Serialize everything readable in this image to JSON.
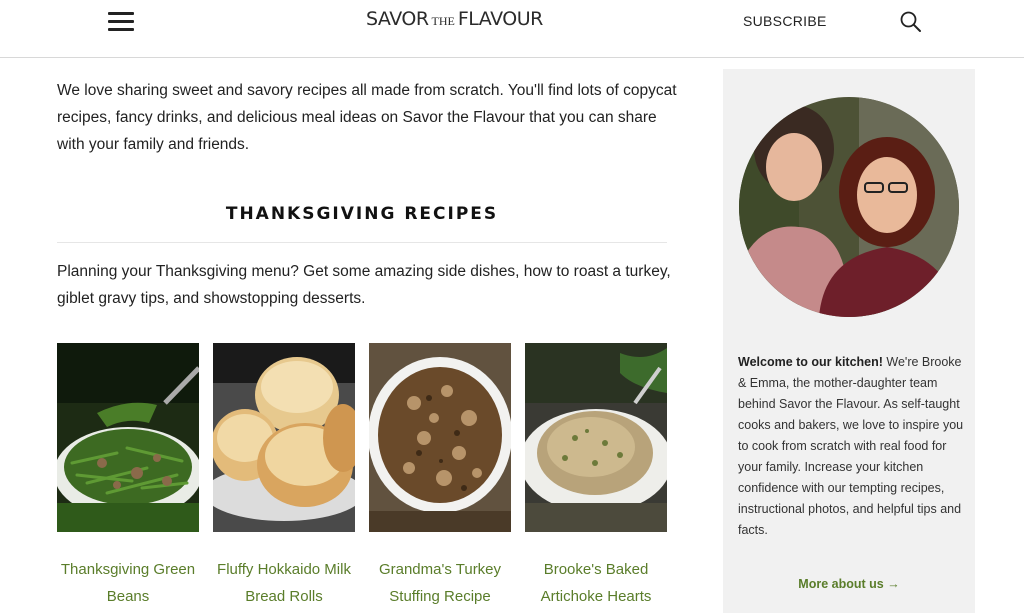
{
  "header": {
    "logo_main_1": "SAVOR",
    "logo_the": "THE",
    "logo_main_2": "FLAVOUR",
    "subscribe_label": "SUBSCRIBE",
    "menu_icon": "hamburger-icon",
    "search_icon": "search-icon"
  },
  "main": {
    "intro": "We love sharing sweet and savory recipes all made from scratch. You'll find lots of copycat recipes, fancy drinks, and delicious meal ideas on Savor the Flavour that you can share with your family and friends.",
    "section_title": "THANKSGIVING RECIPES",
    "section_description": "Planning your Thanksgiving menu? Get some amazing side dishes, how to roast a turkey, giblet gravy tips, and showstopping desserts.",
    "recipes": [
      {
        "title": "Thanksgiving Green Beans"
      },
      {
        "title": "Fluffy Hokkaido Milk Bread Rolls"
      },
      {
        "title": "Grandma's Turkey Stuffing Recipe"
      },
      {
        "title": "Brooke's Baked Artichoke Hearts"
      }
    ]
  },
  "sidebar": {
    "welcome_bold": "Welcome to our kitchen!",
    "welcome_text": " We're Brooke & Emma, the mother-daughter team behind Savor the Flavour. As self-taught cooks and bakers, we love to inspire you to cook from scratch with real food for your family. Increase your kitchen confidence with our tempting recipes, instructional photos, and helpful tips and facts.",
    "more_link": "More about us →"
  },
  "colors": {
    "link_green": "#5a7d2a",
    "sidebar_bg": "#f1f1f1",
    "text": "#222222"
  }
}
